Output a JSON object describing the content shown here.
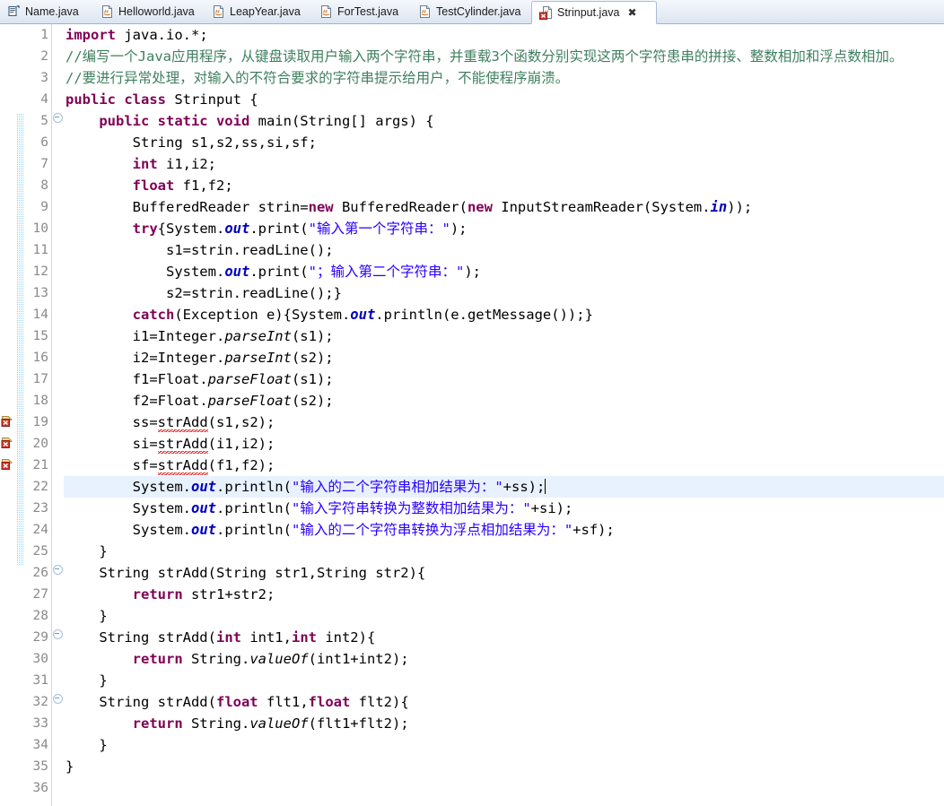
{
  "window": {
    "app": "Eclipse IDE",
    "active_file": "Strinput.java"
  },
  "tabs": [
    {
      "label": "Name.java",
      "icon": "java-class-icon",
      "active": false,
      "error": false
    },
    {
      "label": "Helloworld.java",
      "icon": "java-file-icon",
      "active": false,
      "error": false
    },
    {
      "label": "LeapYear.java",
      "icon": "java-file-icon",
      "active": false,
      "error": false
    },
    {
      "label": "ForTest.java",
      "icon": "java-file-icon",
      "active": false,
      "error": false
    },
    {
      "label": "TestCylinder.java",
      "icon": "java-file-icon",
      "active": false,
      "error": false
    },
    {
      "label": "Strinput.java",
      "icon": "java-file-error-icon",
      "active": true,
      "error": true,
      "close": "✖"
    }
  ],
  "editor": {
    "current_line": 22,
    "total_lines": 36,
    "error_lines": [
      19,
      20,
      21
    ],
    "fold_lines": [
      5,
      26,
      29,
      32
    ],
    "change_bar_ranges": [
      [
        5,
        25
      ]
    ],
    "colors": {
      "keyword": "#7f0055",
      "comment": "#3f7f5f",
      "string": "#2a00ff",
      "field": "#0000c0",
      "current_line_highlight": "#e8f2fe",
      "line_number": "#8a8a8a",
      "error_squiggle": "#d40000",
      "change_bar": "#3f8fd0"
    },
    "lines": [
      {
        "n": 1,
        "fold": false,
        "error": false,
        "tokens": [
          {
            "t": "import",
            "c": "kw"
          },
          {
            "t": " java.io.*;",
            "c": "pln"
          }
        ]
      },
      {
        "n": 2,
        "fold": false,
        "error": false,
        "tokens": [
          {
            "t": "//编写一个Java应用程序，从键盘读取用户输入两个字符串，并重载3个函数分别实现这两个字符患串的拼接、整数相加和浮点数相加。",
            "c": "cmt"
          }
        ]
      },
      {
        "n": 3,
        "fold": false,
        "error": false,
        "tokens": [
          {
            "t": "//要进行异常处理，对输入的不符合要求的字符串提示给用户，不能使程序崩溃。",
            "c": "cmt"
          }
        ]
      },
      {
        "n": 4,
        "fold": false,
        "error": false,
        "tokens": [
          {
            "t": "public class",
            "c": "kw"
          },
          {
            "t": " Strinput {",
            "c": "pln"
          }
        ]
      },
      {
        "n": 5,
        "fold": true,
        "error": false,
        "tokens": [
          {
            "t": "    ",
            "c": "pln"
          },
          {
            "t": "public static void",
            "c": "kw"
          },
          {
            "t": " main(String[] args) {",
            "c": "pln"
          }
        ]
      },
      {
        "n": 6,
        "fold": false,
        "error": false,
        "tokens": [
          {
            "t": "        String s1,s2,ss,si,sf;",
            "c": "pln"
          }
        ]
      },
      {
        "n": 7,
        "fold": false,
        "error": false,
        "tokens": [
          {
            "t": "        ",
            "c": "pln"
          },
          {
            "t": "int",
            "c": "kw"
          },
          {
            "t": " i1,i2;",
            "c": "pln"
          }
        ]
      },
      {
        "n": 8,
        "fold": false,
        "error": false,
        "tokens": [
          {
            "t": "        ",
            "c": "pln"
          },
          {
            "t": "float",
            "c": "kw"
          },
          {
            "t": " f1,f2;",
            "c": "pln"
          }
        ]
      },
      {
        "n": 9,
        "fold": false,
        "error": false,
        "tokens": [
          {
            "t": "        BufferedReader strin=",
            "c": "pln"
          },
          {
            "t": "new",
            "c": "kw"
          },
          {
            "t": " BufferedReader(",
            "c": "pln"
          },
          {
            "t": "new",
            "c": "kw"
          },
          {
            "t": " InputStreamReader(System.",
            "c": "pln"
          },
          {
            "t": "in",
            "c": "fld"
          },
          {
            "t": "));",
            "c": "pln"
          }
        ]
      },
      {
        "n": 10,
        "fold": false,
        "error": false,
        "tokens": [
          {
            "t": "        ",
            "c": "pln"
          },
          {
            "t": "try",
            "c": "kw"
          },
          {
            "t": "{System.",
            "c": "pln"
          },
          {
            "t": "out",
            "c": "fld"
          },
          {
            "t": ".print(",
            "c": "pln"
          },
          {
            "t": "\"输入第一个字符串：\"",
            "c": "str"
          },
          {
            "t": ");",
            "c": "pln"
          }
        ]
      },
      {
        "n": 11,
        "fold": false,
        "error": false,
        "tokens": [
          {
            "t": "            s1=strin.readLine();",
            "c": "pln"
          }
        ]
      },
      {
        "n": 12,
        "fold": false,
        "error": false,
        "tokens": [
          {
            "t": "            System.",
            "c": "pln"
          },
          {
            "t": "out",
            "c": "fld"
          },
          {
            "t": ".print(",
            "c": "pln"
          },
          {
            "t": "\"；输入第二个字符串：\"",
            "c": "str"
          },
          {
            "t": ");",
            "c": "pln"
          }
        ]
      },
      {
        "n": 13,
        "fold": false,
        "error": false,
        "tokens": [
          {
            "t": "            s2=strin.readLine();}",
            "c": "pln"
          }
        ]
      },
      {
        "n": 14,
        "fold": false,
        "error": false,
        "tokens": [
          {
            "t": "        ",
            "c": "pln"
          },
          {
            "t": "catch",
            "c": "kw"
          },
          {
            "t": "(Exception e){System.",
            "c": "pln"
          },
          {
            "t": "out",
            "c": "fld"
          },
          {
            "t": ".println(e.getMessage());}",
            "c": "pln"
          }
        ]
      },
      {
        "n": 15,
        "fold": false,
        "error": false,
        "tokens": [
          {
            "t": "        i1=Integer.",
            "c": "pln"
          },
          {
            "t": "parseInt",
            "c": "stm"
          },
          {
            "t": "(s1);",
            "c": "pln"
          }
        ]
      },
      {
        "n": 16,
        "fold": false,
        "error": false,
        "tokens": [
          {
            "t": "        i2=Integer.",
            "c": "pln"
          },
          {
            "t": "parseInt",
            "c": "stm"
          },
          {
            "t": "(s2);",
            "c": "pln"
          }
        ]
      },
      {
        "n": 17,
        "fold": false,
        "error": false,
        "tokens": [
          {
            "t": "        f1=Float.",
            "c": "pln"
          },
          {
            "t": "parseFloat",
            "c": "stm"
          },
          {
            "t": "(s1);",
            "c": "pln"
          }
        ]
      },
      {
        "n": 18,
        "fold": false,
        "error": false,
        "tokens": [
          {
            "t": "        f2=Float.",
            "c": "pln"
          },
          {
            "t": "parseFloat",
            "c": "stm"
          },
          {
            "t": "(s2);",
            "c": "pln"
          }
        ]
      },
      {
        "n": 19,
        "fold": false,
        "error": true,
        "tokens": [
          {
            "t": "        ss=",
            "c": "pln"
          },
          {
            "t": "strAdd",
            "c": "pln",
            "squiggle": "error"
          },
          {
            "t": "(s1,s2);",
            "c": "pln"
          }
        ]
      },
      {
        "n": 20,
        "fold": false,
        "error": true,
        "tokens": [
          {
            "t": "        si=",
            "c": "pln"
          },
          {
            "t": "strAdd",
            "c": "pln",
            "squiggle": "error"
          },
          {
            "t": "(i1,i2);",
            "c": "pln"
          }
        ]
      },
      {
        "n": 21,
        "fold": false,
        "error": true,
        "tokens": [
          {
            "t": "        sf=",
            "c": "pln"
          },
          {
            "t": "strAdd",
            "c": "pln",
            "squiggle": "error"
          },
          {
            "t": "(f1,f2);",
            "c": "pln"
          }
        ]
      },
      {
        "n": 22,
        "fold": false,
        "error": false,
        "caret": true,
        "tokens": [
          {
            "t": "        System.",
            "c": "pln"
          },
          {
            "t": "out",
            "c": "fld"
          },
          {
            "t": ".println(",
            "c": "pln"
          },
          {
            "t": "\"输入的二个字符串相加结果为：\"",
            "c": "str"
          },
          {
            "t": "+ss);",
            "c": "pln"
          }
        ]
      },
      {
        "n": 23,
        "fold": false,
        "error": false,
        "tokens": [
          {
            "t": "        System.",
            "c": "pln"
          },
          {
            "t": "out",
            "c": "fld"
          },
          {
            "t": ".println(",
            "c": "pln"
          },
          {
            "t": "\"输入字符串转换为整数相加结果为：\"",
            "c": "str"
          },
          {
            "t": "+si);",
            "c": "pln"
          }
        ]
      },
      {
        "n": 24,
        "fold": false,
        "error": false,
        "tokens": [
          {
            "t": "        System.",
            "c": "pln"
          },
          {
            "t": "out",
            "c": "fld"
          },
          {
            "t": ".println(",
            "c": "pln"
          },
          {
            "t": "\"输入的二个字符串转换为浮点相加结果为：\"",
            "c": "str"
          },
          {
            "t": "+sf);",
            "c": "pln"
          }
        ]
      },
      {
        "n": 25,
        "fold": false,
        "error": false,
        "tokens": [
          {
            "t": "    }",
            "c": "pln"
          }
        ]
      },
      {
        "n": 26,
        "fold": true,
        "error": false,
        "tokens": [
          {
            "t": "    String strAdd(String str1,String str2){",
            "c": "pln"
          }
        ]
      },
      {
        "n": 27,
        "fold": false,
        "error": false,
        "tokens": [
          {
            "t": "        ",
            "c": "pln"
          },
          {
            "t": "return",
            "c": "kw"
          },
          {
            "t": " str1+str2;",
            "c": "pln"
          }
        ]
      },
      {
        "n": 28,
        "fold": false,
        "error": false,
        "tokens": [
          {
            "t": "    }",
            "c": "pln"
          }
        ]
      },
      {
        "n": 29,
        "fold": true,
        "error": false,
        "tokens": [
          {
            "t": "    String strAdd(",
            "c": "pln"
          },
          {
            "t": "int",
            "c": "kw"
          },
          {
            "t": " int1,",
            "c": "pln"
          },
          {
            "t": "int",
            "c": "kw"
          },
          {
            "t": " int2){",
            "c": "pln"
          }
        ]
      },
      {
        "n": 30,
        "fold": false,
        "error": false,
        "tokens": [
          {
            "t": "        ",
            "c": "pln"
          },
          {
            "t": "return",
            "c": "kw"
          },
          {
            "t": " String.",
            "c": "pln"
          },
          {
            "t": "valueOf",
            "c": "stm"
          },
          {
            "t": "(int1+int2);",
            "c": "pln"
          }
        ]
      },
      {
        "n": 31,
        "fold": false,
        "error": false,
        "tokens": [
          {
            "t": "    }",
            "c": "pln"
          }
        ]
      },
      {
        "n": 32,
        "fold": true,
        "error": false,
        "tokens": [
          {
            "t": "    String strAdd(",
            "c": "pln"
          },
          {
            "t": "float",
            "c": "kw"
          },
          {
            "t": " flt1,",
            "c": "pln"
          },
          {
            "t": "float",
            "c": "kw"
          },
          {
            "t": " flt2){",
            "c": "pln"
          }
        ]
      },
      {
        "n": 33,
        "fold": false,
        "error": false,
        "tokens": [
          {
            "t": "        ",
            "c": "pln"
          },
          {
            "t": "return",
            "c": "kw"
          },
          {
            "t": " String.",
            "c": "pln"
          },
          {
            "t": "valueOf",
            "c": "stm"
          },
          {
            "t": "(flt1+flt2);",
            "c": "pln"
          }
        ]
      },
      {
        "n": 34,
        "fold": false,
        "error": false,
        "tokens": [
          {
            "t": "    }",
            "c": "pln"
          }
        ]
      },
      {
        "n": 35,
        "fold": false,
        "error": false,
        "tokens": [
          {
            "t": "}",
            "c": "pln"
          }
        ]
      },
      {
        "n": 36,
        "fold": false,
        "error": false,
        "tokens": [
          {
            "t": "",
            "c": "pln"
          }
        ]
      }
    ]
  }
}
